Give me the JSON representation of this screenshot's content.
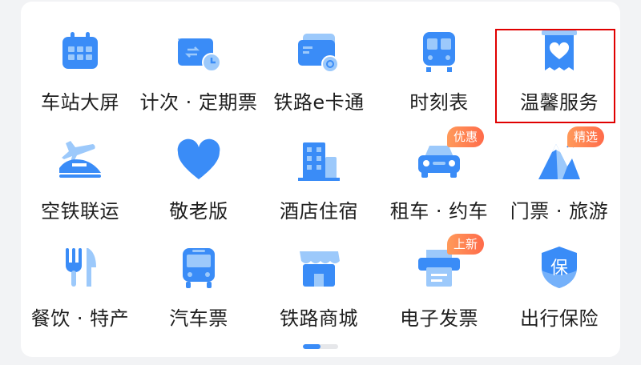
{
  "accent": "#3a8cf7",
  "accent_light": "#9cc9fb",
  "badge_color": "#ff7a50",
  "highlight_color": "#e00000",
  "rows": [
    [
      {
        "label": "车站大屏",
        "icon": "calendar-icon"
      },
      {
        "label": "计次 · 定期票",
        "icon": "ticket-clock-icon"
      },
      {
        "label": "铁路e卡通",
        "icon": "railcard-icon"
      },
      {
        "label": "时刻表",
        "icon": "train-front-icon"
      },
      {
        "label": "温馨服务",
        "icon": "heart-bookmark-icon",
        "highlighted": true
      }
    ],
    [
      {
        "label": "空铁联运",
        "icon": "plane-train-icon"
      },
      {
        "label": "敬老版",
        "icon": "heart-icon"
      },
      {
        "label": "酒店住宿",
        "icon": "hotel-building-icon"
      },
      {
        "label": "租车 · 约车",
        "icon": "car-icon",
        "badge": "优惠"
      },
      {
        "label": "门票 · 旅游",
        "icon": "mountain-icon",
        "badge": "精选"
      }
    ],
    [
      {
        "label": "餐饮 · 特产",
        "icon": "fork-knife-icon"
      },
      {
        "label": "汽车票",
        "icon": "bus-icon"
      },
      {
        "label": "铁路商城",
        "icon": "shop-icon"
      },
      {
        "label": "电子发票",
        "icon": "invoice-printer-icon",
        "badge": "上新"
      },
      {
        "label": "出行保险",
        "icon": "shield-bao-icon",
        "shield_text": "保"
      }
    ]
  ],
  "pager": {
    "pages": 2,
    "current": 1,
    "fill_fraction": 0.5
  }
}
